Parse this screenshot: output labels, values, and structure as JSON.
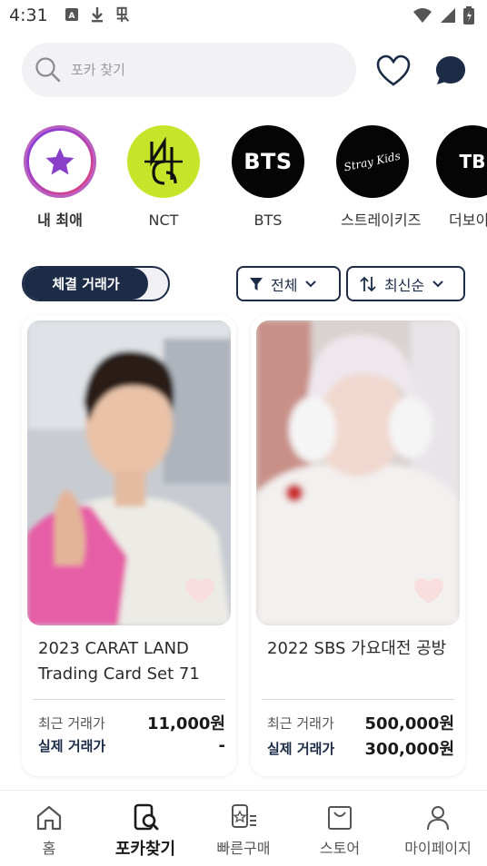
{
  "status_bar": {
    "time": "4:31"
  },
  "search": {
    "placeholder": "포카 찾기"
  },
  "groups": [
    {
      "label": "내 최애",
      "logo_text": ""
    },
    {
      "label": "NCT",
      "logo_text": "NCT"
    },
    {
      "label": "BTS",
      "logo_text": "BTS"
    },
    {
      "label": "스트레이키즈",
      "logo_text": "Stray Kids"
    },
    {
      "label": "더보이",
      "logo_text": "TB"
    }
  ],
  "toggle": {
    "label": "체결 거래가",
    "state": "on"
  },
  "filters": {
    "category": "전체",
    "sort": "최신순"
  },
  "cards": [
    {
      "title": "2023 CARAT LAND Trading Card Set 71",
      "recent_label": "최근 거래가",
      "recent_price": "11,000원",
      "real_label": "실제 거래가",
      "real_price": "-"
    },
    {
      "title": "2022 SBS 가요대전 공방",
      "recent_label": "최근 거래가",
      "recent_price": "500,000원",
      "real_label": "실제 거래가",
      "real_price": "300,000원"
    }
  ],
  "tabs": [
    {
      "label": "홈",
      "icon": "home-icon",
      "active": false
    },
    {
      "label": "포카찾기",
      "icon": "card-search-icon",
      "active": true
    },
    {
      "label": "빠른구매",
      "icon": "fast-buy-icon",
      "active": false
    },
    {
      "label": "스토어",
      "icon": "store-icon",
      "active": false
    },
    {
      "label": "마이페이지",
      "icon": "profile-icon",
      "active": false
    }
  ],
  "colors": {
    "navy": "#1c2b46",
    "nct_green": "#c6e52a",
    "heart_pink": "#f8dede",
    "favorite_gradient": [
      "#7b3fe4",
      "#e5407f"
    ]
  }
}
